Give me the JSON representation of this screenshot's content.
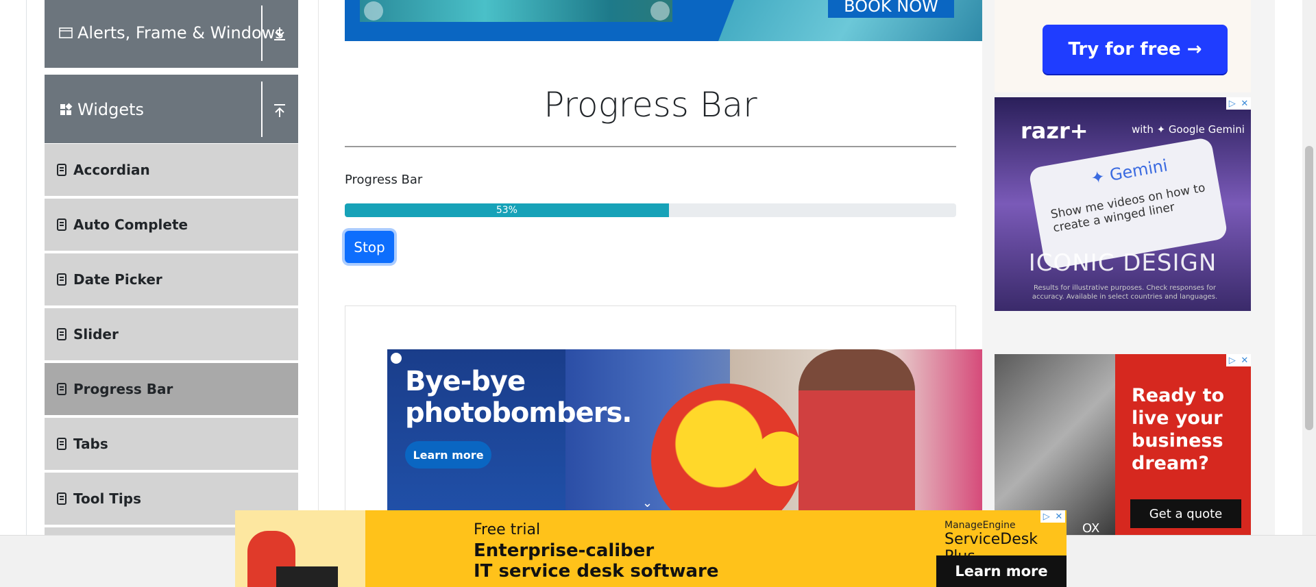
{
  "sidebar": {
    "groups": [
      {
        "label": "Alerts, Frame & Windows",
        "icon": "window-icon",
        "arrow": "download-arrow-icon"
      },
      {
        "label": "Widgets",
        "icon": "widgets-icon",
        "arrow": "upload-arrow-icon"
      }
    ],
    "items": [
      {
        "label": "Accordian"
      },
      {
        "label": "Auto Complete"
      },
      {
        "label": "Date Picker"
      },
      {
        "label": "Slider"
      },
      {
        "label": "Progress Bar",
        "active": true
      },
      {
        "label": "Tabs"
      },
      {
        "label": "Tool Tips"
      }
    ]
  },
  "top_banner": {
    "button_label": "BOOK NOW"
  },
  "main": {
    "title": "Progress Bar",
    "progress_label": "Progress Bar",
    "progress_value": 53,
    "progress_text": "53%",
    "stop_label": "Stop"
  },
  "ads": {
    "middle": {
      "headline": "Bye-bye photobombers.",
      "button": "Learn more"
    },
    "right_top": {
      "button": "Try for free →"
    },
    "phone": {
      "brand": "razr+",
      "brand_sub": "with ✦ Google Gemini",
      "gemini": "✦ Gemini",
      "prompt": "Show me videos on how to create a winged liner",
      "tagline": "ICONIC DESIGN",
      "fine_print": "Results for illustrative purposes. Check responses for accuracy. Available in select countries and languages."
    },
    "quote": {
      "headline": "Ready to live your business dream?",
      "button": "Get a quote",
      "fragment": "OX"
    },
    "bottom": {
      "line1": "Free trial",
      "line2": "Enterprise-caliber",
      "line3": "IT service desk software",
      "brand": "ManageEngine",
      "product": "ServiceDesk Plus",
      "button": "Learn more"
    }
  },
  "colors": {
    "sidebar_group": "#6c757d",
    "sidebar_item": "#d3d3d3",
    "sidebar_active": "#a9a9a9",
    "progress_fill": "#17a2b8",
    "primary_button": "#0d6efd"
  }
}
